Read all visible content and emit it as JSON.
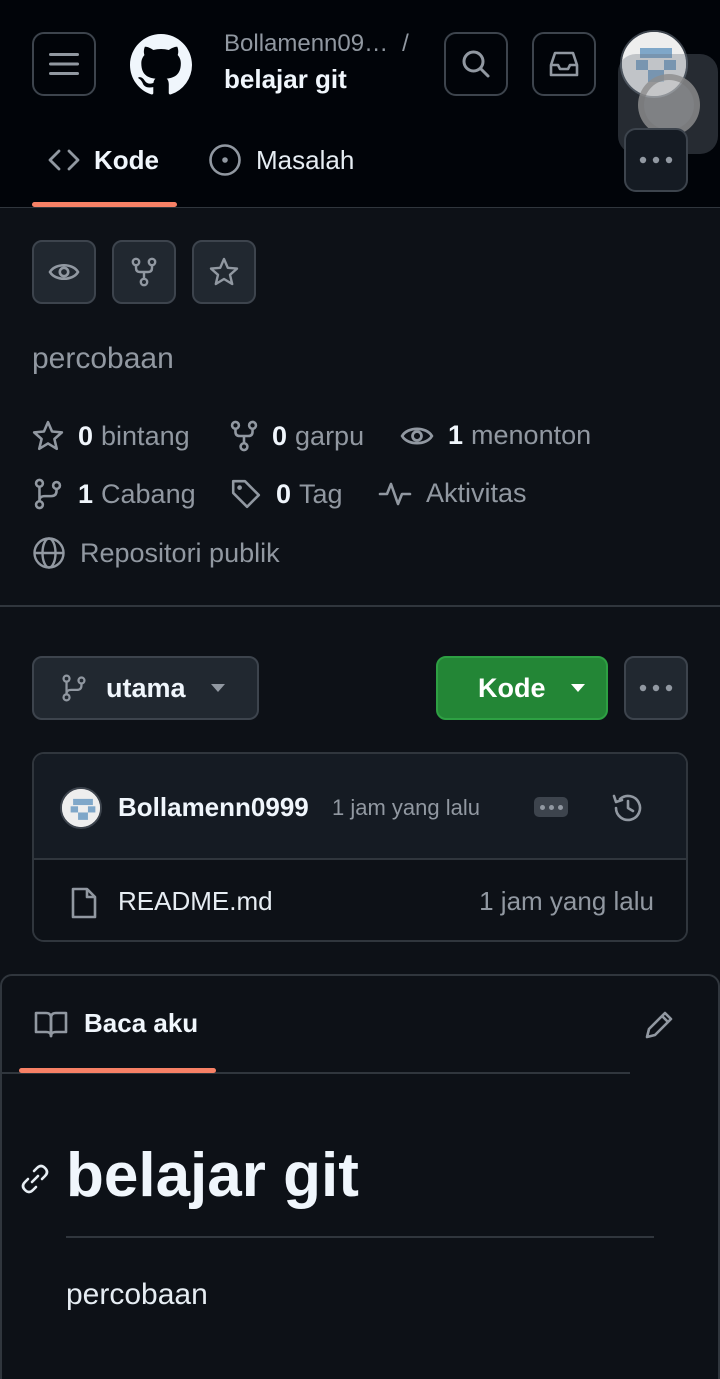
{
  "header": {
    "owner": "Bollamenn09…",
    "separator": "/",
    "repo_name": "belajar git"
  },
  "tabs": [
    {
      "label": "Kode",
      "active": true
    },
    {
      "label": "Masalah",
      "active": false
    }
  ],
  "repo": {
    "description": "percobaan",
    "stats": {
      "stars_count": "0",
      "stars_label": "bintang",
      "forks_count": "0",
      "forks_label": "garpu",
      "watchers_count": "1",
      "watchers_label": "menonton",
      "branches_count": "1",
      "branches_label": "Cabang",
      "tags_count": "0",
      "tags_label": "Tag",
      "activity_label": "Aktivitas",
      "visibility_label": "Repositori publik"
    }
  },
  "toolbar": {
    "branch_name": "utama",
    "code_button": "Kode"
  },
  "latest_commit": {
    "author": "Bollamenn0999",
    "time": "1 jam yang lalu"
  },
  "files": [
    {
      "name": "README.md",
      "time": "1 jam yang lalu"
    }
  ],
  "readme": {
    "tab_label": "Baca aku",
    "heading": "belajar git",
    "body": "percobaan"
  },
  "colors": {
    "background": "#0d1117",
    "header_bg": "#010409",
    "accent_underline": "#f78166",
    "primary_button": "#238636",
    "border": "#30363d",
    "muted_text": "#9198a1"
  },
  "icons": [
    "hamburger-menu-icon",
    "github-logo-icon",
    "search-icon",
    "inbox-icon",
    "code-icon",
    "issue-icon",
    "kebab-icon",
    "eye-icon",
    "fork-icon",
    "star-icon",
    "branch-icon",
    "tag-icon",
    "pulse-icon",
    "globe-icon",
    "caret-down-icon",
    "history-icon",
    "file-icon",
    "book-icon",
    "pencil-icon",
    "link-icon"
  ]
}
